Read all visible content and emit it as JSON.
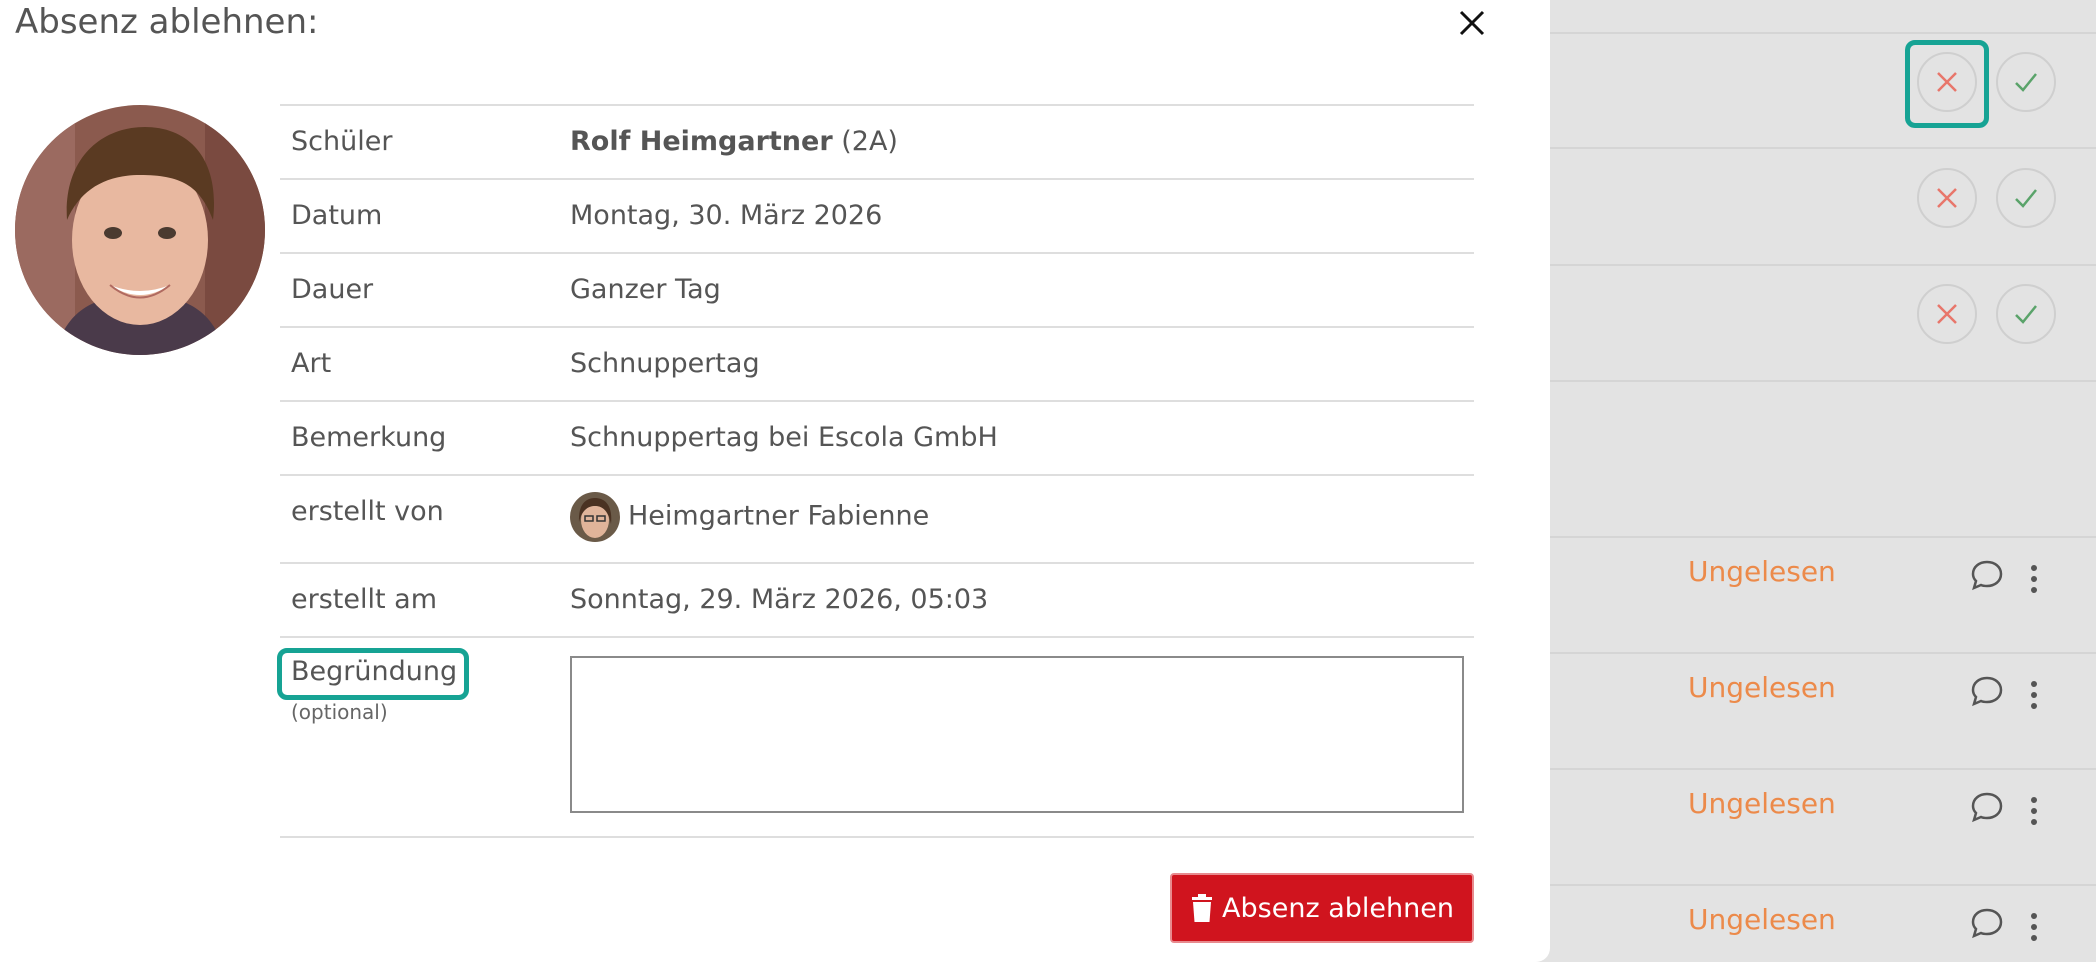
{
  "modal": {
    "title": "Absenz ablehnen:",
    "details": [
      {
        "label": "Schüler",
        "value_bold": "Rolf Heimgartner",
        "value": " (2A)"
      },
      {
        "label": "Datum",
        "value": "Montag, 30. März 2026"
      },
      {
        "label": "Dauer",
        "value": "Ganzer Tag"
      },
      {
        "label": "Art",
        "value": "Schnuppertag"
      },
      {
        "label": "Bemerkung",
        "value": "Schnuppertag bei Escola GmbH"
      },
      {
        "label": "erstellt von",
        "value": "Heimgartner Fabienne"
      },
      {
        "label": "erstellt am",
        "value": "Sonntag, 29. März 2026, 05:03"
      }
    ],
    "reason": {
      "label": "Begründung",
      "hint": "(optional)",
      "value": ""
    },
    "submit_label": "Absenz ablehnen"
  },
  "background": {
    "status_label": "Ungelesen",
    "colors": {
      "accent": "#16a394",
      "danger": "#d0141e",
      "status": "#ec8a4a",
      "reject_icon": "#e8766b",
      "approve_icon": "#5aa36a"
    }
  }
}
